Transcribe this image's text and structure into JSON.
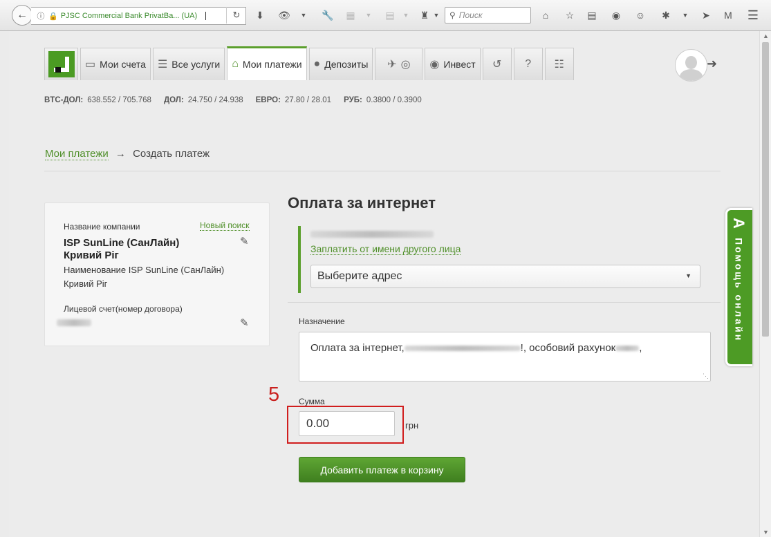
{
  "browser": {
    "url_site": "PJSC Commercial Bank PrivatBa... (UA)",
    "url_text": "",
    "search_placeholder": "Поиск"
  },
  "nav": {
    "tabs": [
      {
        "label": "Мои счета",
        "icon": "card-icon"
      },
      {
        "label": "Все услуги",
        "icon": "list-icon"
      },
      {
        "label": "Мои платежи",
        "icon": "home-icon",
        "active": true
      },
      {
        "label": "Депозиты",
        "icon": "piggy-bank-icon"
      },
      {
        "label": "",
        "icon": "travel-icon"
      },
      {
        "label": "Инвест",
        "icon": "money-bag-icon"
      },
      {
        "label": "",
        "icon": "history-icon"
      },
      {
        "label": "",
        "icon": "help-icon"
      },
      {
        "label": "",
        "icon": "cart-icon"
      }
    ]
  },
  "rates": [
    {
      "label": "BTC-ДОЛ:",
      "value": "638.552 / 705.768"
    },
    {
      "label": "ДОЛ:",
      "value": "24.750 / 24.938"
    },
    {
      "label": "ЕВРО:",
      "value": "27.80 / 28.01"
    },
    {
      "label": "РУБ:",
      "value": "0.3800 / 0.3900"
    }
  ],
  "breadcrumb": {
    "link": "Мои платежи",
    "arrow": "→",
    "current": "Создать платеж"
  },
  "company_card": {
    "company_label": "Название компании",
    "new_search": "Новый поиск",
    "company_name": "ISP SunLine (СанЛайн) Кривий Ріг",
    "company_full": "Наименование ISP SunLine (СанЛайн) Кривий Ріг",
    "account_label": "Лицевой счет(номер договора)"
  },
  "form": {
    "title": "Оплата за интернет",
    "other_person_link": "Заплатить от имени другого лица",
    "address_select": "Выберите адрес",
    "purpose_label": "Назначение",
    "purpose_prefix": "Оплата за інтернет,",
    "purpose_middle": "!, особовий рахунок",
    "purpose_suffix": ",",
    "sum_label": "Сумма",
    "sum_value": "0.00",
    "currency": "грн",
    "submit_button": "Добавить платеж в корзину"
  },
  "annotation": {
    "step_number": "5",
    "color": "#d01d1d"
  },
  "help_tab": {
    "letter": "A",
    "text": "Помощь онлайн"
  },
  "colors": {
    "brand_green": "#4f8f29",
    "button_green": "#4f9a2a",
    "highlight_red": "#d01d1d"
  }
}
